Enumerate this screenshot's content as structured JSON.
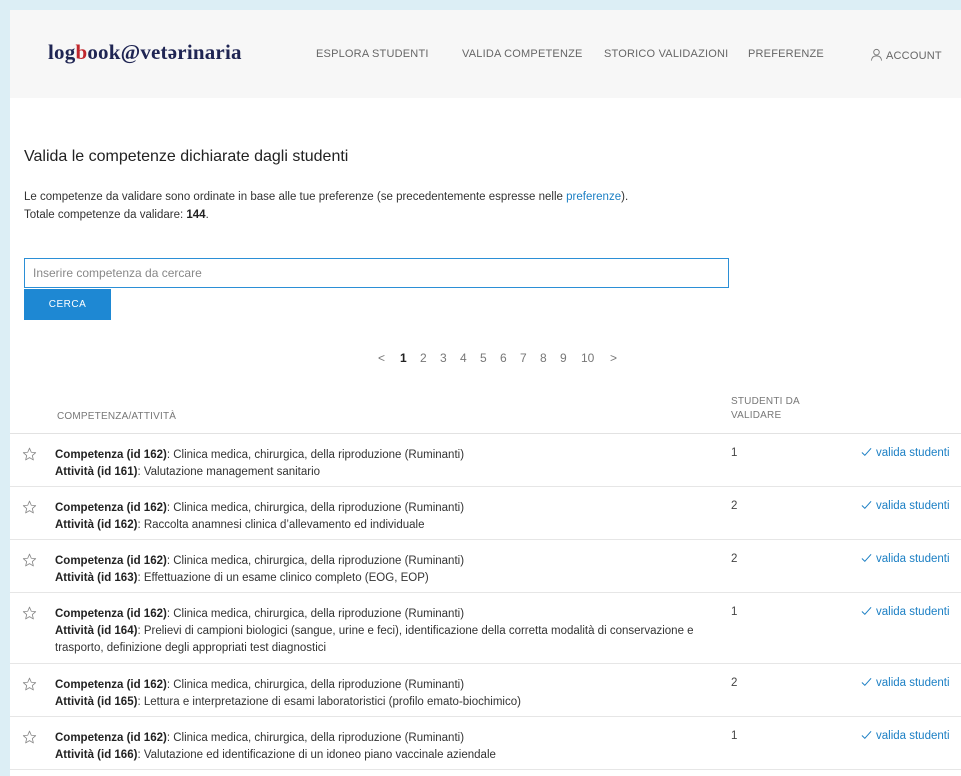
{
  "header": {
    "logo_part1": "log",
    "logo_part2": "b",
    "logo_part3": "ook@vet",
    "logo_part4": "ə",
    "logo_part5": "rinaria",
    "nav": [
      {
        "label": "ESPLORA STUDENTI"
      },
      {
        "label": "VALIDA COMPETENZE"
      },
      {
        "label": "STORICO VALIDAZIONI"
      },
      {
        "label": "PREFERENZE"
      }
    ],
    "account_label": "ACCOUNT"
  },
  "main": {
    "title": "Valida le competenze dichiarate dagli studenti",
    "desc_pre": "Le competenze da validare sono ordinate in base alle tue preferenze (se precedentemente espresse nelle ",
    "desc_link": "preferenze",
    "desc_post": ").",
    "total_label": "Totale competenze da validare: ",
    "total_value": "144",
    "total_suffix": "."
  },
  "search": {
    "placeholder": "Inserire competenza da cercare",
    "value": "",
    "button_label": "CERCA"
  },
  "pagination": {
    "prev": "<",
    "pages": [
      "1",
      "2",
      "3",
      "4",
      "5",
      "6",
      "7",
      "8",
      "9",
      "10"
    ],
    "current": "1",
    "next": ">"
  },
  "table": {
    "col_competenza": "COMPETENZA/ATTIVITÀ",
    "col_studenti_line1": "STUDENTI DA",
    "col_studenti_line2": "VALIDARE",
    "competenza_label": "Competenza (id 162)",
    "competenza_text": ": Clinica medica, chirurgica, della riproduzione (Ruminanti)",
    "validate_label": "valida studenti",
    "rows": [
      {
        "attivita_label": "Attività (id 161)",
        "attivita_text": ": Valutazione management sanitario",
        "count": "1"
      },
      {
        "attivita_label": "Attività (id 162)",
        "attivita_text": ": Raccolta anamnesi clinica d’allevamento ed individuale",
        "count": "2"
      },
      {
        "attivita_label": "Attività (id 163)",
        "attivita_text": ": Effettuazione di un esame clinico completo (EOG, EOP)",
        "count": "2"
      },
      {
        "attivita_label": "Attività (id 164)",
        "attivita_text": ": Prelievi di campioni biologici (sangue, urine e feci), identificazione della corretta modalità di conservazione e trasporto, definizione degli appropriati test diagnostici",
        "count": "1"
      },
      {
        "attivita_label": "Attività (id 165)",
        "attivita_text": ": Lettura e interpretazione di esami laboratoristici (profilo emato-biochimico)",
        "count": "2"
      },
      {
        "attivita_label": "Attività (id 166)",
        "attivita_text": ": Valutazione ed identificazione di un idoneo piano vaccinale aziendale",
        "count": "1"
      }
    ]
  },
  "colors": {
    "accent": "#1e88d3",
    "link": "#1b7fc4",
    "logo_navy": "#1f2553",
    "logo_red": "#c0272d",
    "page_frame": "#dceef5"
  },
  "icons": {
    "account": "user-icon",
    "star": "star-outline-icon",
    "check": "check-icon"
  }
}
